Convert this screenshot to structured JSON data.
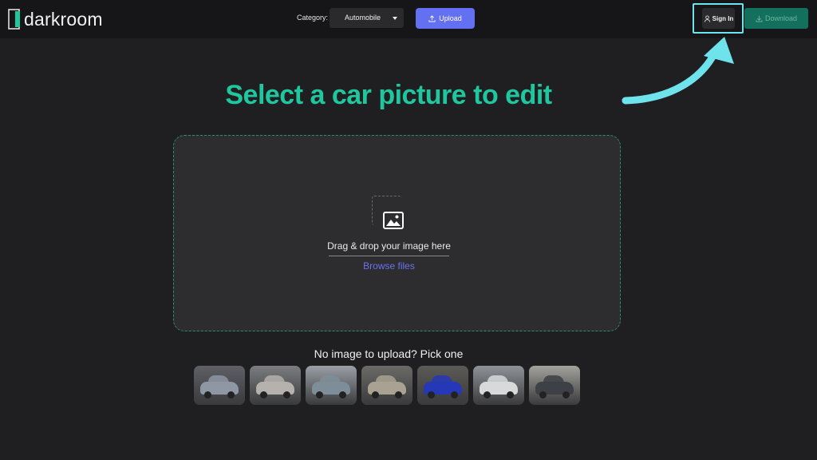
{
  "header": {
    "logo_text": "darkroom",
    "category_label": "Category:",
    "category_value": "Automobile",
    "upload_label": "Upload",
    "signin_label": "Sign In",
    "download_label": "Download"
  },
  "main": {
    "headline": "Select a car picture to edit",
    "dropzone": {
      "title": "Drag & drop your image here",
      "browse": "Browse files"
    },
    "samples": {
      "title": "No image to upload? Pick one",
      "thumbs": [
        {
          "icon": "car-thumbnail",
          "color": "#8e97a3"
        },
        {
          "icon": "car-thumbnail",
          "color": "#b5b2ad"
        },
        {
          "icon": "car-thumbnail",
          "color": "#7e8e99"
        },
        {
          "icon": "car-thumbnail",
          "color": "#a9a292"
        },
        {
          "icon": "car-thumbnail",
          "color": "#2438b8"
        },
        {
          "icon": "car-thumbnail",
          "color": "#d7d9db"
        },
        {
          "icon": "car-thumbnail",
          "color": "#3d4047"
        }
      ]
    }
  },
  "colors": {
    "accent_green": "#1fc69e",
    "primary_blue": "#6370f2",
    "highlight_cyan": "#6fe3ec",
    "download_green": "#13705c"
  }
}
